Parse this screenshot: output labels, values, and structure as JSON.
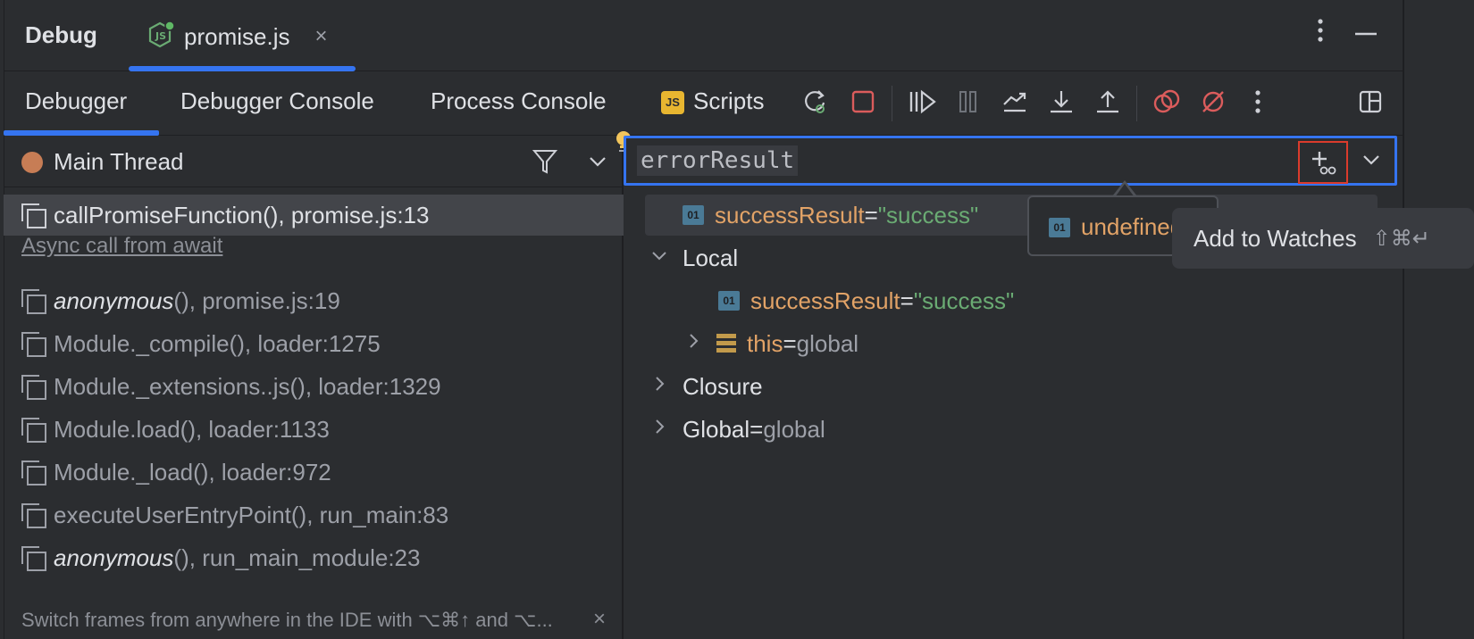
{
  "title_bar": {
    "title": "Debug",
    "file_tab": "promise.js",
    "close_glyph": "×"
  },
  "tabs": {
    "debugger": "Debugger",
    "debugger_console": "Debugger Console",
    "process_console": "Process Console",
    "scripts": "Scripts",
    "scripts_badge": "JS"
  },
  "frames": {
    "thread": "Main Thread",
    "async_label": "Async call from await",
    "items": [
      {
        "name": "callPromiseFunction()",
        "loc": ", promise.js:13"
      },
      {
        "name": "anonymous",
        "suffix": "()",
        "loc": ", promise.js:19"
      },
      {
        "name": "Module._compile()",
        "loc": ", loader:1275"
      },
      {
        "name": "Module._extensions..js()",
        "loc": ", loader:1329"
      },
      {
        "name": "Module.load()",
        "loc": ", loader:1133"
      },
      {
        "name": "Module._load()",
        "loc": ", loader:972"
      },
      {
        "name": "executeUserEntryPoint()",
        "loc": ", run_main:83"
      },
      {
        "name": "anonymous",
        "suffix": "()",
        "loc": ", run_main_module:23"
      }
    ],
    "hint": "Switch frames from anywhere in the IDE with ⌥⌘↑ and ⌥...",
    "hint_close": "×"
  },
  "variables": {
    "eval_expression": "errorResult",
    "prim_badge": "01",
    "watch_row": {
      "name": "successResult",
      "eq": " = ",
      "value": "\"success\""
    },
    "local_label": "Local",
    "local_var": {
      "name": "successResult",
      "eq": " = ",
      "value": "\"success\""
    },
    "this_var": {
      "name": "this",
      "eq": " = ",
      "value": "global"
    },
    "closure_label": "Closure",
    "global_label": "Global",
    "global_eq": " = ",
    "global_value": "global"
  },
  "popup": {
    "value": "undefined"
  },
  "tooltip": {
    "title": "Add to Watches",
    "shortcut": "⇧⌘↵"
  },
  "colors": {
    "accent": "#3574F0",
    "stop_red": "#DB5C5C",
    "thread_dot": "#C77D55",
    "string": "#6AAB73",
    "var_name": "#E2A367"
  }
}
